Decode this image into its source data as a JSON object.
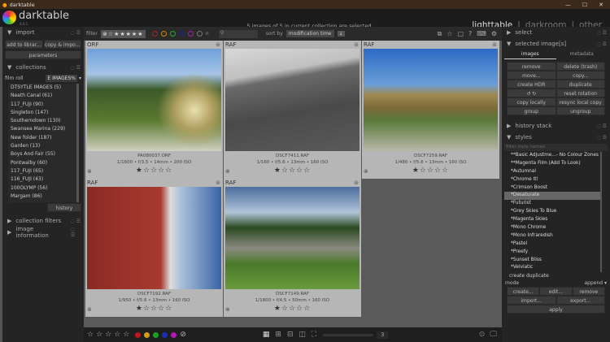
{
  "window": {
    "title": "darktable"
  },
  "header": {
    "brand": "darktable",
    "version": "4.0.1",
    "message": "5 images of 5 in current collection are selected",
    "views": [
      "lighttable",
      "darkroom",
      "other"
    ],
    "separator": "|"
  },
  "left": {
    "import": {
      "title": "import",
      "add": "add to librar...",
      "copy": "copy & impo...",
      "parameters": "parameters"
    },
    "collections": {
      "title": "collections",
      "property": "film roll",
      "value": "E IMAGES%",
      "items": [
        "DTSYTLE IMAGES (5)",
        "Neath Canal (61)",
        "117_FUJI (90)",
        "Singleton (147)",
        "Southerndown (130)",
        "Swansea Marina (229)",
        "New folder (187)",
        "Garden (13)",
        "Boys And Fair (55)",
        "Pontwalby (60)",
        "117_FUJI (65)",
        "116_FUJI (43)",
        "100OLYMP (56)",
        "Margam (86)"
      ],
      "history": "history"
    },
    "filters": {
      "title": "collection filters"
    },
    "info": {
      "title": "image information"
    }
  },
  "filterbar": {
    "label": "filter",
    "stars": "⊗☆★★★★★",
    "sort_label": "sort by",
    "sort_value": "modification time"
  },
  "images": [
    {
      "ext": "ORF",
      "file": "PA080037.ORF",
      "exif": "1/1600 • f/3.5 • 14mm • 200 ISO",
      "rating": 1
    },
    {
      "ext": "RAF",
      "file": "DSCF7411.RAF",
      "exif": "1/160 • f/5.6 • 13mm • 160 ISO",
      "rating": 1
    },
    {
      "ext": "RAF",
      "file": "DSCF7259.RAF",
      "exif": "1/480 • f/5.6 • 13mm • 160 ISO",
      "rating": 1
    },
    {
      "ext": "RAF",
      "file": "DSCF7192.RAF",
      "exif": "1/950 • f/5.6 • 13mm • 160 ISO",
      "rating": 1
    },
    {
      "ext": "RAF",
      "file": "DSCF7149.RAF",
      "exif": "1/1800 • f/4.5 • 50mm • 160 ISO",
      "rating": 1
    }
  ],
  "bottom": {
    "zoom_count": "3",
    "color_labels": [
      "#c0191b",
      "#d39b1a",
      "#1aa11f",
      "#1a2fb8",
      "#b01ab0"
    ]
  },
  "right": {
    "select": "select",
    "selected": {
      "title": "selected image[s]",
      "tabs": [
        "images",
        "metadata"
      ],
      "buttons": [
        "remove",
        "delete (trash)",
        "move...",
        "copy...",
        "create HDR",
        "duplicate",
        "↺   ↻",
        "reset rotation",
        "copy locally",
        "resync local copy",
        "group",
        "ungroup"
      ]
    },
    "history": "history stack",
    "styles": {
      "title": "styles",
      "placeholder": "filter style names",
      "items": [
        "**Basic Adjustme...- No Colour Zones",
        "**Magenta Film (Add To Look)",
        "*Autumnal",
        "*Chrome It!",
        "*Crimson Boost",
        "*Desaturate",
        "*Futurist",
        "*Grey Skies To Blue",
        "*Magenta Skies",
        "*Mono Chrome",
        "*Mono Infraredish",
        "*Pastel",
        "*Preefy",
        "*Sunset Bliss",
        "*Velviatic"
      ],
      "selected": "*Desaturate",
      "create_duplicate": "create duplicate",
      "mode_label": "mode",
      "mode_value": "append",
      "create": "create...",
      "edit": "edit...",
      "remove": "remove",
      "import": "import...",
      "export": "export...",
      "apply": "apply"
    }
  }
}
